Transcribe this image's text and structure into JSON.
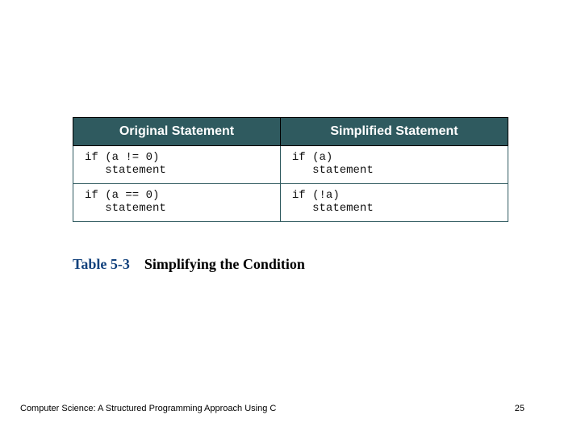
{
  "table": {
    "headers": [
      "Original Statement",
      "Simplified Statement"
    ],
    "rows": [
      {
        "original": "if (a != 0)\n   statement",
        "simplified": "if (a)\n   statement"
      },
      {
        "original": "if (a == 0)\n   statement",
        "simplified": "if (!a)\n   statement"
      }
    ]
  },
  "caption": {
    "label": "Table  5-3",
    "title": "Simplifying the Condition"
  },
  "footer": {
    "left": "Computer Science: A Structured Programming Approach Using C",
    "page": "25"
  }
}
